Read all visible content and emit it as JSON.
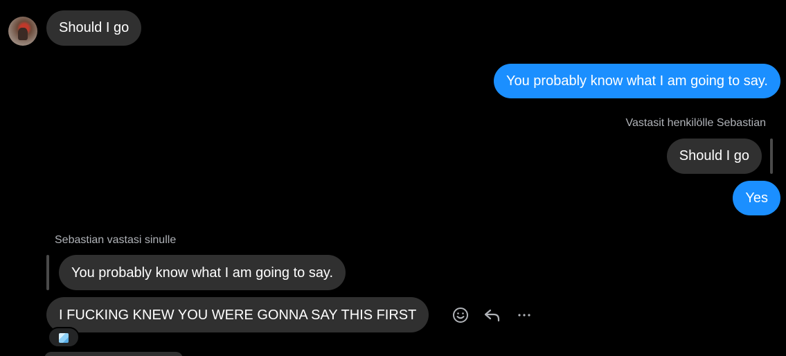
{
  "messages": [
    {
      "side": "incoming",
      "text": "Should I go"
    },
    {
      "side": "outgoing",
      "text": "You probably know what I am  going to say."
    },
    {
      "side": "outgoing-reply-label",
      "text": "Vastasit henkilölle Sebastian"
    },
    {
      "side": "quoted",
      "text": "Should I go"
    },
    {
      "side": "outgoing",
      "text": "Yes"
    },
    {
      "side": "incoming-reply-label",
      "text": "Sebastian vastasi sinulle"
    },
    {
      "side": "quoted",
      "text": "You probably know what I am going to say."
    },
    {
      "side": "incoming",
      "text": "I FUCKING KNEW YOU WERE GONNA SAY THIS FIRST"
    }
  ],
  "reaction": {
    "icon": "ice-cube-icon"
  },
  "actions": [
    {
      "icon": "smiley-icon"
    },
    {
      "icon": "reply-arrow-icon"
    },
    {
      "icon": "more-dots-icon"
    }
  ],
  "colors": {
    "background": "#000000",
    "incoming_bubble": "#303030",
    "outgoing_bubble": "#1b8fff",
    "label": "#b0b3b8"
  }
}
